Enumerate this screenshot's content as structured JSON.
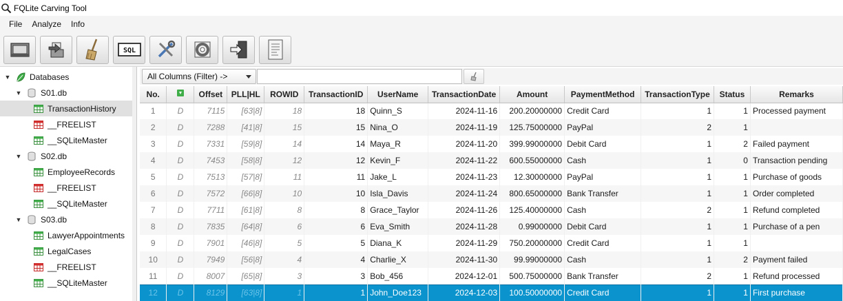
{
  "window": {
    "title": "FQLite Carving Tool"
  },
  "menu": [
    "File",
    "Analyze",
    "Info"
  ],
  "toolbar": {
    "buttons": [
      "open-database",
      "export",
      "clean",
      "sql-analyzer",
      "settings",
      "help",
      "exit",
      "log"
    ],
    "sql_label": "SQL"
  },
  "tree": {
    "root": "Databases",
    "databases": [
      {
        "name": "S01.db",
        "tables": [
          "TransactionHistory",
          "__FREELIST",
          "__SQLiteMaster"
        ]
      },
      {
        "name": "S02.db",
        "tables": [
          "EmployeeRecords",
          "__FREELIST",
          "__SQLiteMaster"
        ]
      },
      {
        "name": "S03.db",
        "tables": [
          "LawyerAppointments",
          "LegalCases",
          "__FREELIST",
          "__SQLiteMaster"
        ]
      }
    ],
    "selected": "TransactionHistory"
  },
  "filter": {
    "select_label": "All Columns (Filter) ->",
    "input_value": ""
  },
  "table": {
    "columns": [
      "No.",
      "",
      "Offset",
      "PLL|HL",
      "ROWID",
      "TransactionID",
      "UserName",
      "TransactionDate",
      "Amount",
      "PaymentMethod",
      "TransactionType",
      "Status",
      "Remarks"
    ],
    "rows": [
      [
        "1",
        "D",
        "7115",
        "[63|8]",
        "18",
        "18",
        "Quinn_S",
        "2024-11-16",
        "200.20000000",
        "Credit Card",
        "1",
        "1",
        "Processed payment"
      ],
      [
        "2",
        "D",
        "7288",
        "[41|8]",
        "15",
        "15",
        "Nina_O",
        "2024-11-19",
        "125.75000000",
        "PayPal",
        "2",
        "1",
        ""
      ],
      [
        "3",
        "D",
        "7331",
        "[59|8]",
        "14",
        "14",
        "Maya_R",
        "2024-11-20",
        "399.99000000",
        "Debit Card",
        "1",
        "2",
        "Failed payment"
      ],
      [
        "4",
        "D",
        "7453",
        "[58|8]",
        "12",
        "12",
        "Kevin_F",
        "2024-11-22",
        "600.55000000",
        "Cash",
        "1",
        "0",
        "Transaction pending"
      ],
      [
        "5",
        "D",
        "7513",
        "[57|8]",
        "11",
        "11",
        "Jake_L",
        "2024-11-23",
        "12.30000000",
        "PayPal",
        "1",
        "1",
        "Purchase of goods"
      ],
      [
        "6",
        "D",
        "7572",
        "[66|8]",
        "10",
        "10",
        "Isla_Davis",
        "2024-11-24",
        "800.65000000",
        "Bank Transfer",
        "1",
        "1",
        "Order completed"
      ],
      [
        "7",
        "D",
        "7711",
        "[61|8]",
        "8",
        "8",
        "Grace_Taylor",
        "2024-11-26",
        "125.40000000",
        "Cash",
        "2",
        "1",
        "Refund completed"
      ],
      [
        "8",
        "D",
        "7835",
        "[64|8]",
        "6",
        "6",
        "Eva_Smith",
        "2024-11-28",
        "0.99000000",
        "Debit Card",
        "1",
        "1",
        "Purchase of a pen"
      ],
      [
        "9",
        "D",
        "7901",
        "[46|8]",
        "5",
        "5",
        "Diana_K",
        "2024-11-29",
        "750.20000000",
        "Credit Card",
        "1",
        "1",
        ""
      ],
      [
        "10",
        "D",
        "7949",
        "[56|8]",
        "4",
        "4",
        "Charlie_X",
        "2024-11-30",
        "99.99000000",
        "Cash",
        "1",
        "2",
        "Payment failed"
      ],
      [
        "11",
        "D",
        "8007",
        "[65|8]",
        "3",
        "3",
        "Bob_456",
        "2024-12-01",
        "500.75000000",
        "Bank Transfer",
        "2",
        "1",
        "Refund processed"
      ],
      [
        "12",
        "D",
        "8129",
        "[63|8]",
        "1",
        "1",
        "John_Doe123",
        "2024-12-03",
        "100.50000000",
        "Credit Card",
        "1",
        "1",
        "First purchase"
      ]
    ],
    "selected_row": 11
  },
  "colors": {
    "selection": "#0a93cd",
    "accent_green": "#3fae49",
    "freelist_red": "#d32f2f"
  }
}
